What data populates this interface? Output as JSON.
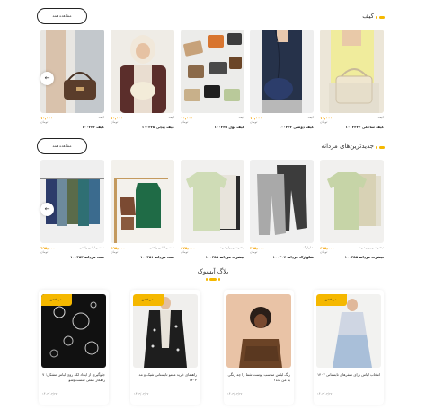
{
  "sections": {
    "bags": {
      "title": "کیف",
      "more_label": "مشاهده همه"
    },
    "mens": {
      "title": "جدیدترین‌های مردانه",
      "more_label": "مشاهده همه"
    },
    "blog": {
      "title": "بلاگ آیسوک"
    }
  },
  "bags_products": [
    {
      "category": "کیف",
      "price": "۱۰,۰۰۰",
      "currency": "تومان",
      "name": "کیف ساحلی ۱۰۰۳۴۳۲"
    },
    {
      "category": "کیف",
      "price": "۱۰,۰۰۰",
      "currency": "تومان",
      "name": "کیف دوشی ۱۰۰۴۳۳"
    },
    {
      "category": "کیف",
      "price": "۱۰,۰۰۰",
      "currency": "تومان",
      "name": "کیف پول ۱۰۰۳۴۵"
    },
    {
      "category": "کیف",
      "price": "۱۰,۰۰۰",
      "currency": "تومان",
      "name": "کیف پیچی ۱۰۰۳۳۵"
    },
    {
      "category": "کیف",
      "price": "۱۰,۰۰۰",
      "currency": "تومان",
      "name": "کیف ۱۰۰۳۳۳"
    }
  ],
  "mens_products": [
    {
      "category": "تیشرت و پولوشرت",
      "price": "۶۷۵,۰۰۰",
      "currency": "تومان",
      "name": "تیشرت مردانه ۱۰۰۳۵۵"
    },
    {
      "category": "شلوارک",
      "price": "۴۹۵,۰۰۰",
      "currency": "تومان",
      "name": "شلوارک مردانه ۱۰۰۳۰۷"
    },
    {
      "category": "تیشرت و پولوشرت",
      "price": "۶۷۵,۰۰۰",
      "currency": "تومان",
      "name": "تیشرت مردانه ۱۰۰۳۵۵"
    },
    {
      "category": "ست و لباس راحتی",
      "price": "۹۹۵,۰۰۰",
      "currency": "تومان",
      "name": "ست مردانه ۱۰۰۳۵۱"
    },
    {
      "category": "ست و لباس راحتی",
      "price": "۹۹۵,۰۰۰",
      "currency": "تومان",
      "name": "ست مردانه ۱۰۰۳۵۳"
    }
  ],
  "blog_posts": [
    {
      "badge": "مد و فشن",
      "title": "انتخاب لباس برای سفرهای تابستانی ۱۴۰۳",
      "date": "۱۴۰۳/۰۳/۲۷"
    },
    {
      "badge": "مد و فشن",
      "title": "رنگ لباس مناسب پوست شما را چه رنگی به من بده؟",
      "date": "۱۴۰۳/۰۳/۲۷"
    },
    {
      "badge": "مد و فشن",
      "title": "راهنمای خرید مانتو تابستانی شیک و مد ۱۴۰۳",
      "date": "۱۴۰۳/۰۳/۲۷"
    },
    {
      "badge": "مد و فشن",
      "title": "جلوگیری از ایجاد لکه روی لباس مشکی؛ ۷ راهکار عملی شست‌وشو",
      "date": "۱۴۰۳/۰۳/۲۷"
    }
  ],
  "colors": {
    "accent": "#f5b800",
    "price": "#f5a200"
  }
}
